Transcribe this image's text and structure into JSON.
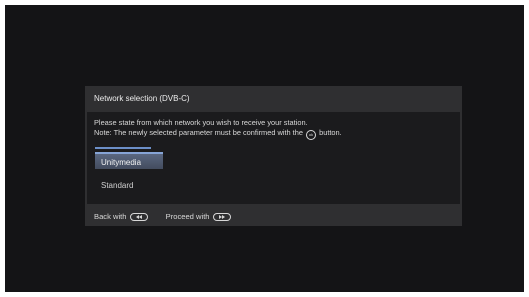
{
  "dialog": {
    "title": "Network selection (DVB-C)",
    "instruction_line1": "Please state from which network you wish to receive your station.",
    "instruction_line2_pre": "Note: The newly selected parameter must be confirmed with the",
    "ok_glyph": "ok",
    "instruction_line2_post": "button."
  },
  "options": [
    {
      "label": "Unitymedia",
      "selected": true
    },
    {
      "label": "Standard",
      "selected": false
    }
  ],
  "footer": {
    "back_label": "Back with",
    "back_icon": "rewind-key-icon",
    "proceed_label": "Proceed with",
    "proceed_icon": "fast-forward-key-icon"
  },
  "colors": {
    "screen_bg": "#141416",
    "dialog_bg": "#2f2f31",
    "content_bg": "#1b1b1d",
    "highlight": "#4f5a70",
    "accent": "#86a4d6"
  }
}
